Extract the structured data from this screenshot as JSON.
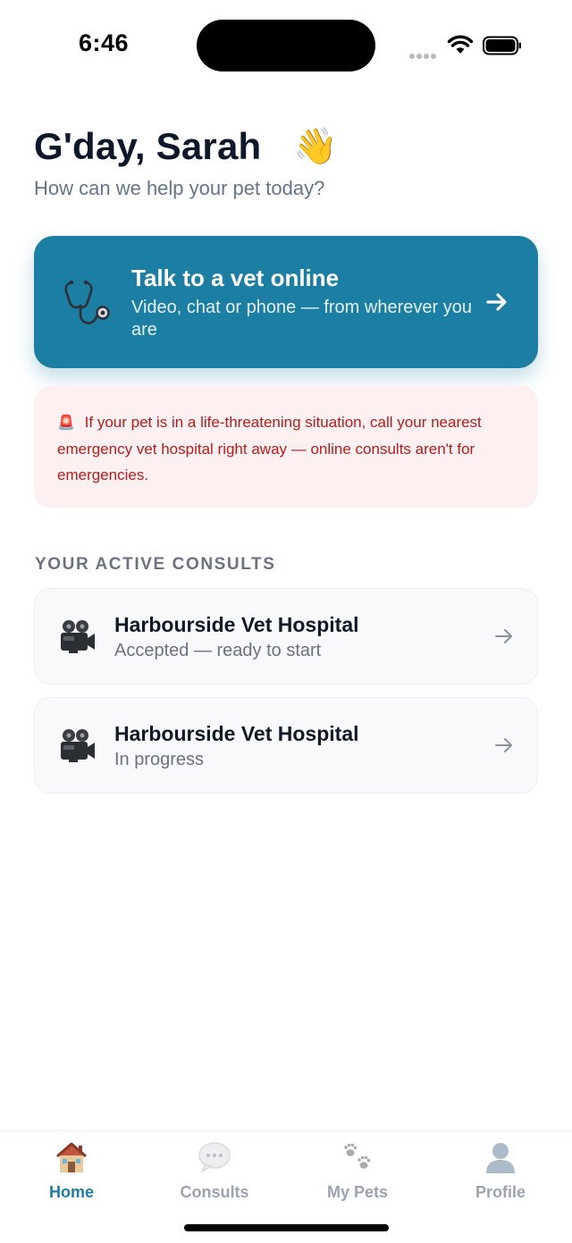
{
  "status_bar": {
    "time": "6:46"
  },
  "header": {
    "greeting": "G'day, Sarah",
    "wave_icon": "👋",
    "subtitle": "How can we help your pet today?"
  },
  "cta": {
    "title": "Talk to a vet online",
    "subtitle": "Video, chat or phone — from wherever you are",
    "icon": "stethoscope-icon",
    "background_color": "#1d7ea3"
  },
  "alert": {
    "icon": "🚨",
    "text": "If your pet is in a life-threatening situation, call your nearest emergency vet hospital right away — online consults aren't for emergencies.",
    "text_color": "#b71c1c",
    "background_color": "#fdf0f0"
  },
  "consults": {
    "heading": "YOUR ACTIVE CONSULTS",
    "items": [
      {
        "clinic": "Harbourside Vet Hospital",
        "status": "Accepted — ready to start",
        "icon": "movie-camera-icon"
      },
      {
        "clinic": "Harbourside Vet Hospital",
        "status": "In progress",
        "icon": "movie-camera-icon"
      }
    ]
  },
  "tab_bar": {
    "active_color": "#1d7ea3",
    "tabs": [
      {
        "label": "Home",
        "icon": "house-icon",
        "active": true
      },
      {
        "label": "Consults",
        "icon": "chat-bubble-icon",
        "active": false
      },
      {
        "label": "My Pets",
        "icon": "paw-prints-icon",
        "active": false
      },
      {
        "label": "Profile",
        "icon": "person-silhouette-icon",
        "active": false
      }
    ]
  }
}
